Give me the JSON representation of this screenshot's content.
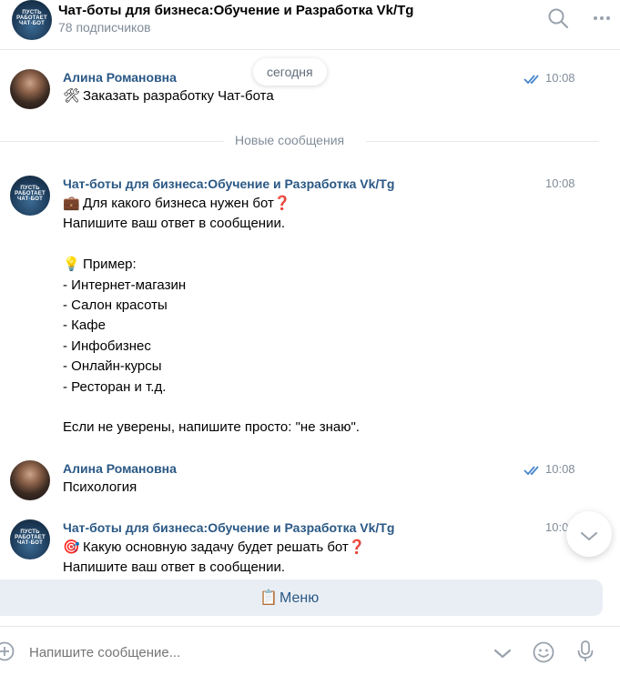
{
  "header": {
    "title": "Чат-боты для бизнеса:Обучение и Разработка Vk/Tg",
    "subtitle": "78 подписчиков",
    "group_avatar_text": [
      "ПУСТЬ",
      "РАБОТАЕТ",
      "ЧАТ-БОТ"
    ]
  },
  "date_badge": "сегодня",
  "new_messages_label": "Новые сообщения",
  "messages": [
    {
      "sender": "Алина Романовна",
      "time": "10:08",
      "read": true,
      "lines": [
        {
          "emoji": "🛠",
          "text": "Заказать разработку Чат-бота"
        }
      ]
    },
    {
      "sender": "Чат-боты для бизнеса:Обучение и Разработка Vk/Tg",
      "time": "10:08",
      "lines": [
        {
          "emoji": "💼",
          "text": "Для какого бизнеса нужен бот❓"
        },
        {
          "text": "Напишите ваш ответ в сообщении."
        },
        {
          "text": ""
        },
        {
          "emoji": "💡",
          "text": "Пример:"
        },
        {
          "text": "- Интернет-магазин"
        },
        {
          "text": "- Салон красоты"
        },
        {
          "text": "- Кафе"
        },
        {
          "text": "- Инфобизнес"
        },
        {
          "text": "- Онлайн-курсы"
        },
        {
          "text": "- Ресторан и т.д."
        },
        {
          "text": ""
        },
        {
          "text": "Если не уверены, напишите просто: \"не знаю\"."
        }
      ]
    },
    {
      "sender": "Алина Романовна",
      "time": "10:08",
      "read": true,
      "lines": [
        {
          "text": "Психология"
        }
      ]
    },
    {
      "sender": "Чат-боты для бизнеса:Обучение и Разработка Vk/Tg",
      "time": "10:0",
      "lines": [
        {
          "emoji": "🎯",
          "text": "Какую основную задачу будет решать бот❓"
        },
        {
          "text": "Напишите ваш ответ в сообщении."
        }
      ]
    }
  ],
  "keyboard_button": {
    "emoji": "📋",
    "label": "Меню"
  },
  "composer": {
    "placeholder": "Напишите сообщение..."
  },
  "icons": {
    "search": "search-icon",
    "more": "more-icon",
    "scroll_down": "chevron-down-icon",
    "attach": "attach-icon",
    "keyboard_toggle": "chevron-down-icon",
    "emoji": "smile-icon",
    "voice": "microphone-icon",
    "read_mark": "double-check-icon"
  },
  "colors": {
    "sender": "#2a5885",
    "meta": "#818c99",
    "icon": "#99a2ad",
    "read_check": "#4986cc",
    "menu_bg": "#e9eef4"
  }
}
